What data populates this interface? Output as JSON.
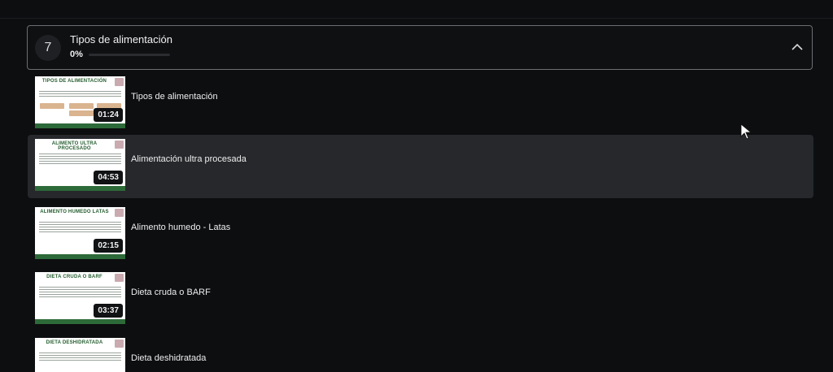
{
  "module": {
    "number": "7",
    "title": "Tipos de alimentación",
    "progress_text": "0%",
    "progress_value": 0
  },
  "lessons": [
    {
      "title": "Tipos de alimentación",
      "duration": "01:24",
      "thumb_title": "TIPOS DE ALIMENTACIÓN"
    },
    {
      "title": "Alimentación ultra procesada",
      "duration": "04:53",
      "thumb_title": "ALIMENTO ULTRA PROCESADO",
      "active": true
    },
    {
      "title": "Alimento humedo - Latas",
      "duration": "02:15",
      "thumb_title": "ALIMENTO HUMEDO LATAS"
    },
    {
      "title": "Dieta cruda o BARF",
      "duration": "03:37",
      "thumb_title": "DIETA CRUDA O BARF"
    },
    {
      "title": "Dieta deshidratada",
      "duration": "",
      "thumb_title": "DIETA DESHIDRATADA"
    }
  ],
  "icons": {
    "chevron": "chevron-up-icon",
    "cursor": "mouse-cursor-icon"
  },
  "colors": {
    "accent_green": "#2d6a39",
    "active_row": "#26282b",
    "background": "#0d0e10"
  }
}
